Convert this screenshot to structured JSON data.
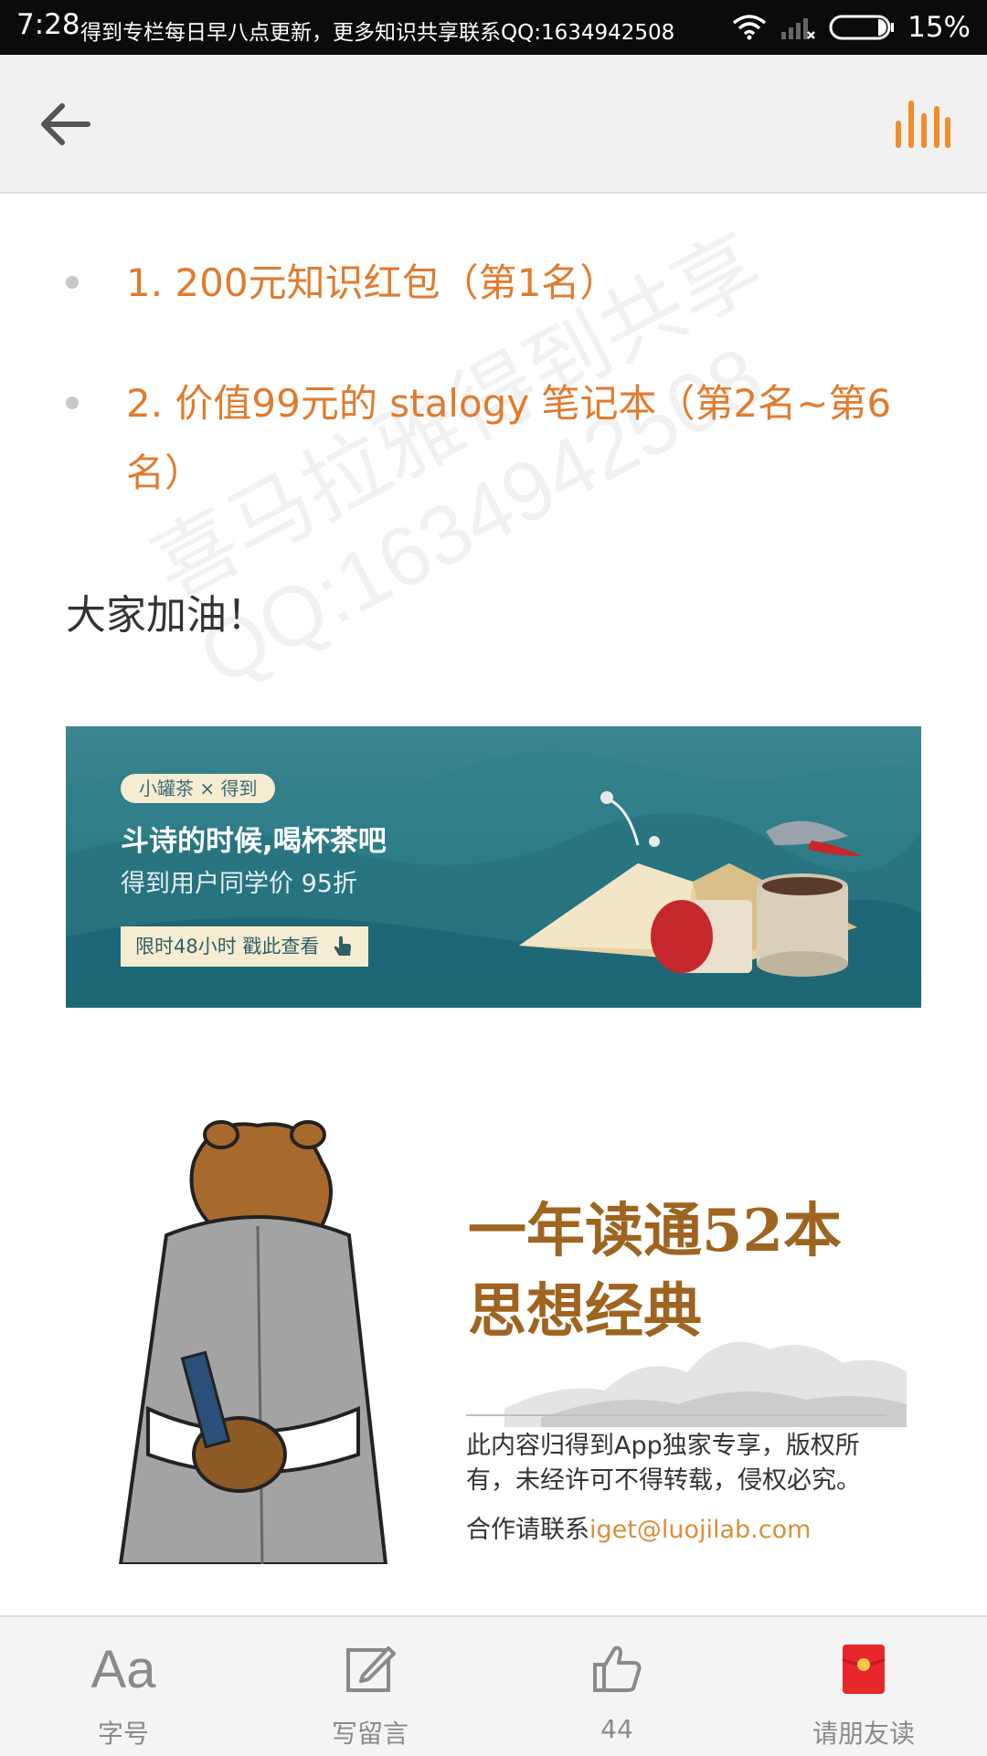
{
  "status_bar": {
    "time": "7:28",
    "message": "得到专栏每日早八点更新，更多知识共享联系QQ:1634942508",
    "battery": "15%"
  },
  "top_nav": {
    "back_icon": "back-arrow-icon",
    "audio_icon": "audio-bars-icon",
    "accent_color": "#f08c2b"
  },
  "article": {
    "bullets": [
      "1. 200元知识红包（第1名）",
      "2. 价值99元的 stalogy 笔记本（第2名~第6名）"
    ],
    "closing": "大家加油！",
    "watermark_lines": [
      "喜马拉雅得到共享",
      "QQ:1634942508"
    ]
  },
  "tea_banner": {
    "tag": "小罐茶 × 得到",
    "title": "斗诗的时候,喝杯茶吧",
    "subtitle": "得到用户同学价 95折",
    "cta": "限时48小时 戳此查看"
  },
  "course_banner": {
    "title_line1": "一年读通52本",
    "title_line2": "思想经典",
    "copyright": "此内容归得到App独家专享，版权所有，未经许可不得转载，侵权必究。",
    "contact_prefix": "合作请联系",
    "contact_email": "iget@luojilab.com"
  },
  "bottom_bar": {
    "font_label": "字号",
    "font_glyph": "Aa",
    "comment_label": "写留言",
    "like_count": "44",
    "share_label": "请朋友读"
  }
}
